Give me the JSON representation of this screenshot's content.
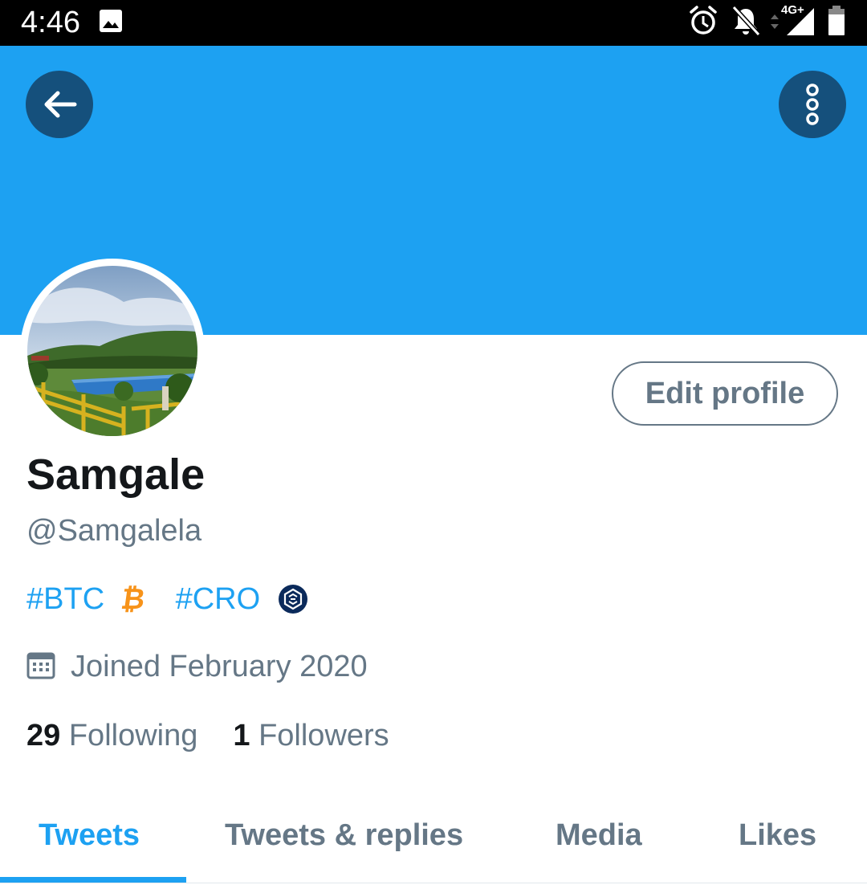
{
  "status_bar": {
    "time": "4:46",
    "network_label": "4G+",
    "icons": [
      "gallery-icon",
      "alarm-icon",
      "notifications-off-icon",
      "signal-icon",
      "battery-icon"
    ]
  },
  "header": {
    "banner_color": "#1da1f2",
    "back_icon": "arrow-left-icon",
    "more_icon": "more-vertical-icon"
  },
  "profile": {
    "display_name": "Samgale",
    "handle": "@Samgalela",
    "bio": {
      "tag1": "#BTC",
      "tag1_emoji": "₿",
      "tag2": "#CRO",
      "tag2_icon": "cro-coin-icon"
    },
    "joined": "Joined February 2020",
    "following_count": "29",
    "following_label": "Following",
    "followers_count": "1",
    "followers_label": "Followers",
    "edit_button": "Edit profile"
  },
  "tabs": [
    {
      "label": "Tweets",
      "active": true
    },
    {
      "label": "Tweets & replies",
      "active": false
    },
    {
      "label": "Media",
      "active": false
    },
    {
      "label": "Likes",
      "active": false
    }
  ],
  "colors": {
    "accent": "#1da1f2",
    "secondary_text": "#657786",
    "primary_text": "#14171a",
    "header_button": "#15507c"
  }
}
